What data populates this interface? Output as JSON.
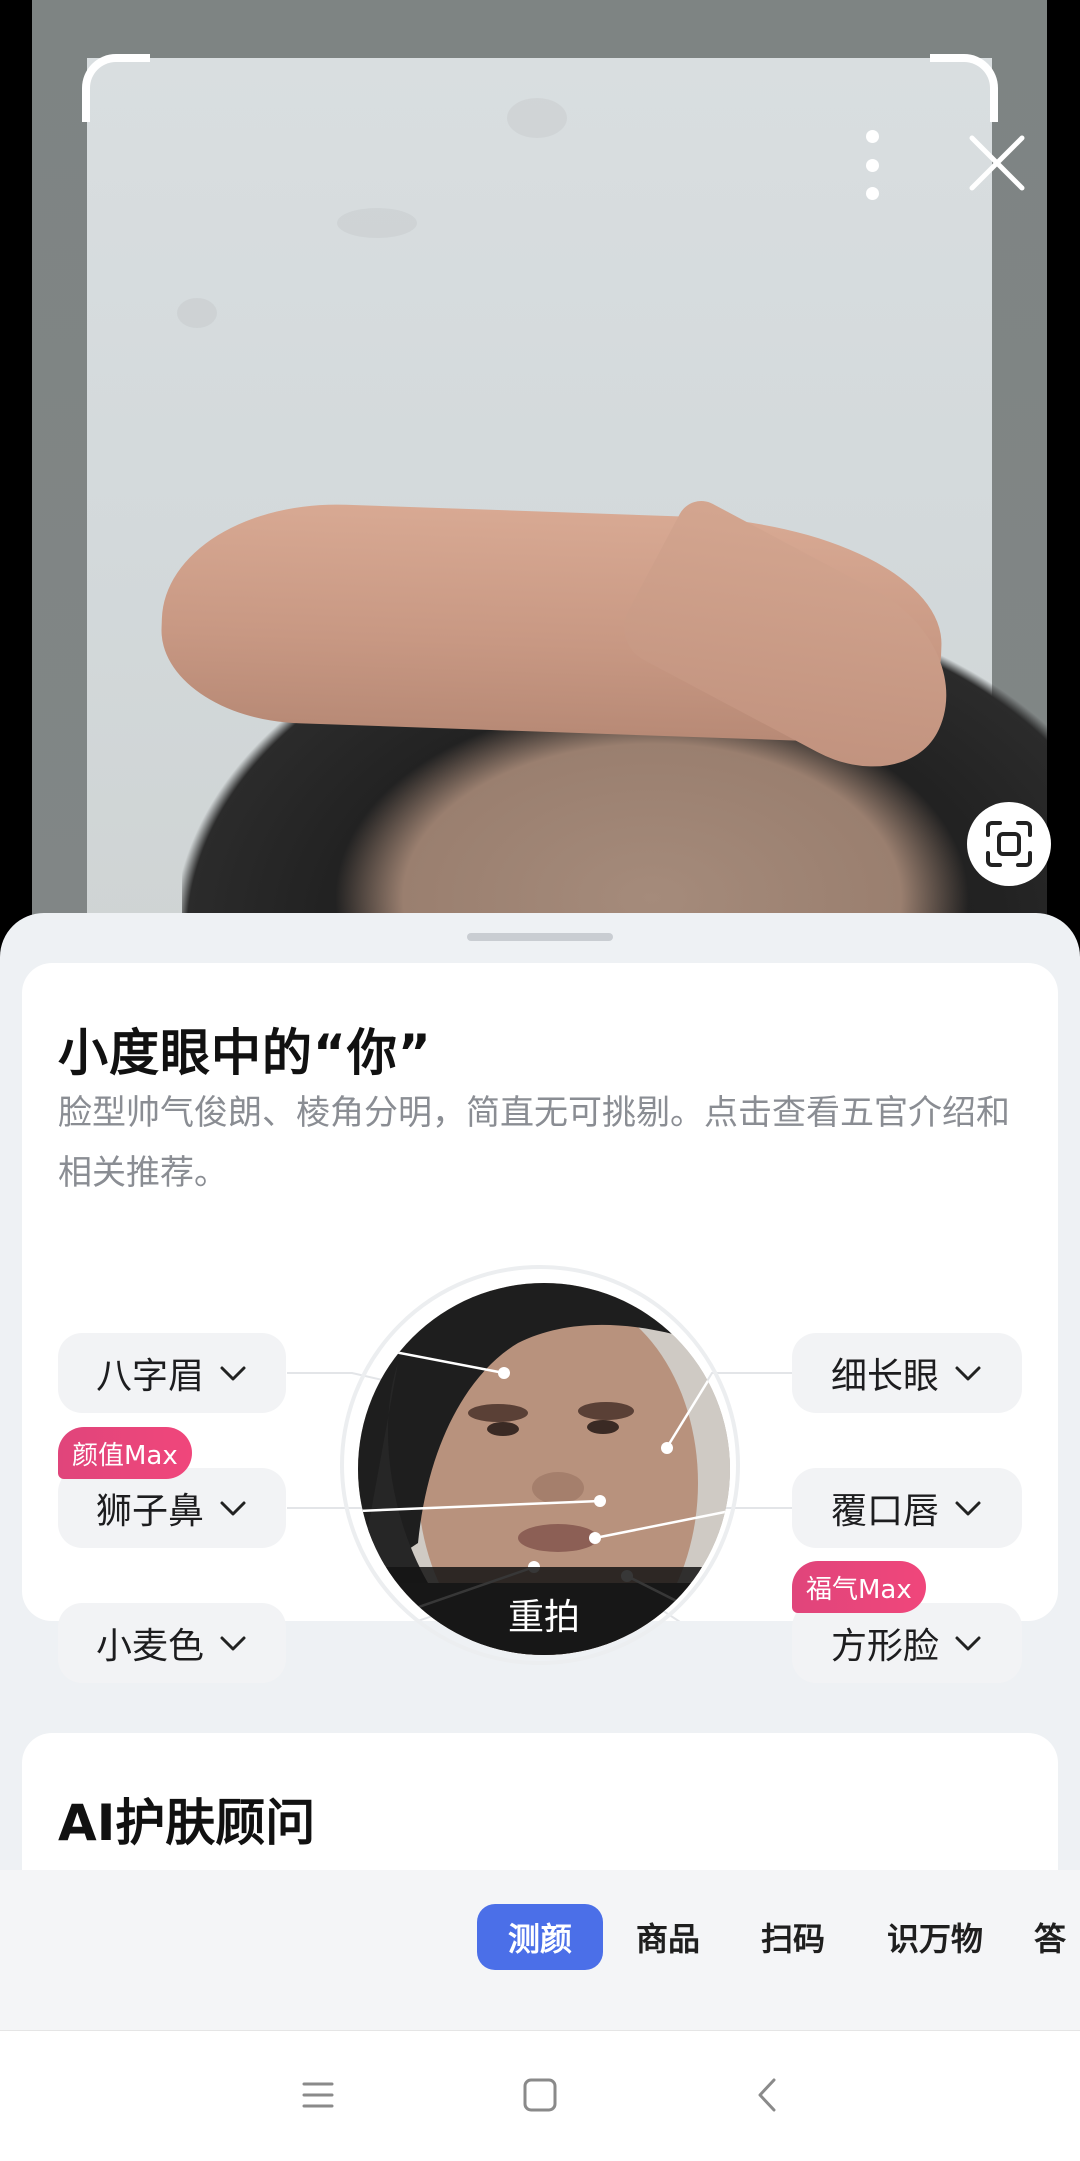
{
  "camera": {
    "more_icon": "more-vertical-icon",
    "close_icon": "close-icon",
    "scan_icon": "scan-frame-icon"
  },
  "face_card": {
    "title": "小度眼中的“你”",
    "description": "脸型帅气俊朗、棱角分明，简直无可挑剔。点击查看五官介绍和相关推荐。",
    "features_left": [
      {
        "label": "八字眉"
      },
      {
        "label": "狮子鼻",
        "badge": "颜值Max"
      },
      {
        "label": "小麦色"
      }
    ],
    "features_right": [
      {
        "label": "细长眼"
      },
      {
        "label": "覆口唇"
      },
      {
        "label": "方形脸",
        "badge": "福气Max"
      }
    ],
    "retake_label": "重拍"
  },
  "ai_card": {
    "title": "AI护肤顾问"
  },
  "modes": {
    "tabs": [
      "测颜",
      "商品",
      "扫码",
      "识万物",
      "答"
    ],
    "active": "测颜",
    "active_color": "#4b6fe8"
  },
  "system_nav": {
    "icons": [
      "menu-icon",
      "home-icon",
      "back-icon"
    ]
  }
}
